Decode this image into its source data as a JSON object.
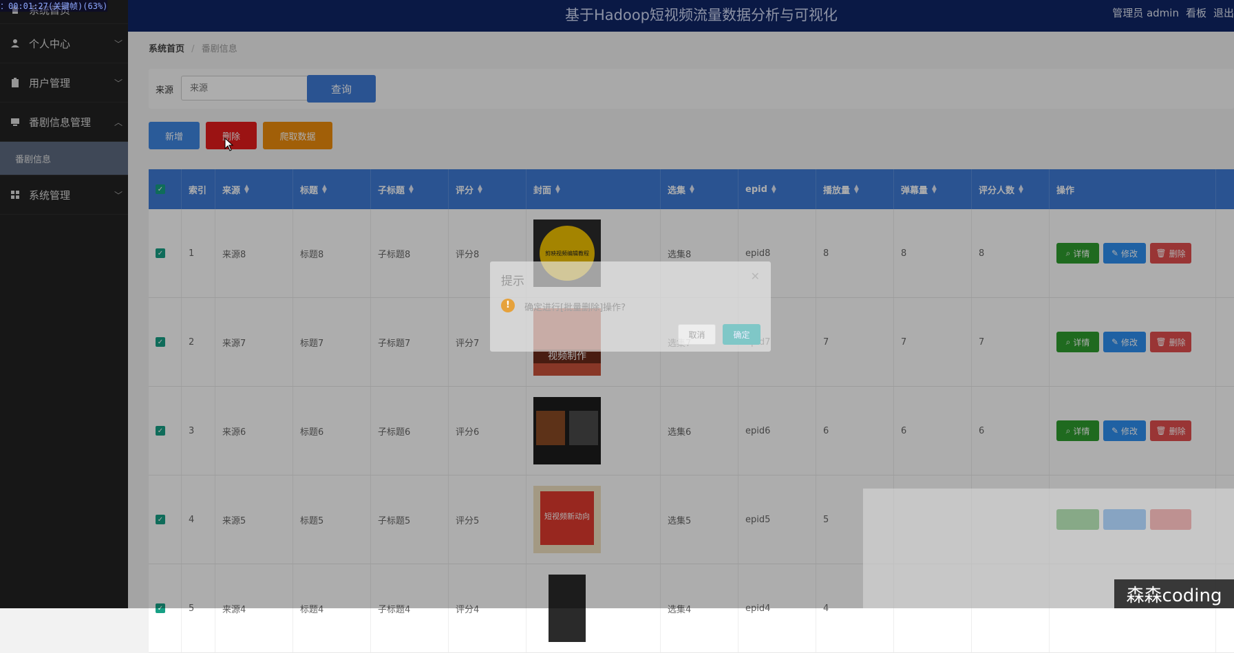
{
  "recording_timer": "：00:01:27(关键帧)(63%)",
  "app_title": "基于Hadoop短视频流量数据分析与可视化",
  "user": {
    "role_name": "管理员 admin",
    "dashboard": "看板",
    "logout": "退出"
  },
  "sidebar": {
    "items": [
      {
        "label": "系统首页"
      },
      {
        "label": "个人中心"
      },
      {
        "label": "用户管理"
      },
      {
        "label": "番剧信息管理"
      },
      {
        "label": "系统管理"
      }
    ],
    "sub_item": "番剧信息"
  },
  "breadcrumb": {
    "home": "系统首页",
    "separator": "/",
    "current": "番剧信息"
  },
  "search": {
    "label": "来源",
    "placeholder": "来源",
    "query_button": "查询"
  },
  "actions": {
    "add": "新增",
    "delete": "删除",
    "crawl": "爬取数据"
  },
  "table": {
    "columns": [
      "索引",
      "来源",
      "标题",
      "子标题",
      "评分",
      "封面",
      "选集",
      "epid",
      "播放量",
      "弹幕量",
      "评分人数",
      "操作"
    ],
    "rows": [
      {
        "index": "1",
        "source": "来源8",
        "title": "标题8",
        "subtitle": "子标题8",
        "score": "评分8",
        "episode": "选集8",
        "epid": "epid8",
        "plays": "8",
        "danmaku": "8",
        "raters": "8",
        "cover_text": "剪映视频编辑教程"
      },
      {
        "index": "2",
        "source": "来源7",
        "title": "标题7",
        "subtitle": "子标题7",
        "score": "评分7",
        "episode": "选集7",
        "epid": "epid7",
        "plays": "7",
        "danmaku": "7",
        "raters": "7",
        "cover_text": "视频制作"
      },
      {
        "index": "3",
        "source": "来源6",
        "title": "标题6",
        "subtitle": "子标题6",
        "score": "评分6",
        "episode": "选集6",
        "epid": "epid6",
        "plays": "6",
        "danmaku": "6",
        "raters": "6",
        "cover_text": ""
      },
      {
        "index": "4",
        "source": "来源5",
        "title": "标题5",
        "subtitle": "子标题5",
        "score": "评分5",
        "episode": "选集5",
        "epid": "epid5",
        "plays": "5",
        "danmaku": "",
        "raters": "",
        "cover_text": "短视频新动向"
      },
      {
        "index": "5",
        "source": "来源4",
        "title": "标题4",
        "subtitle": "子标题4",
        "score": "评分4",
        "episode": "选集4",
        "epid": "epid4",
        "plays": "4",
        "danmaku": "",
        "raters": "",
        "cover_text": ""
      }
    ],
    "row_actions": {
      "detail": "详情",
      "edit": "修改",
      "delete": "删除"
    }
  },
  "dialog": {
    "title": "提示",
    "message": "确定进行[批量删除]操作?",
    "cancel": "取消",
    "confirm": "确定"
  },
  "watermark": "森森coding",
  "colors": {
    "topbar": "#102566",
    "sidebar": "#222222",
    "header": "#3f7bd6",
    "detail": "#2e9d2e",
    "edit": "#2f8ff0",
    "delete": "#e24f4f",
    "add": "#3f86e2",
    "bulk_delete": "#e51c1c",
    "crawl": "#ee8c0c"
  }
}
